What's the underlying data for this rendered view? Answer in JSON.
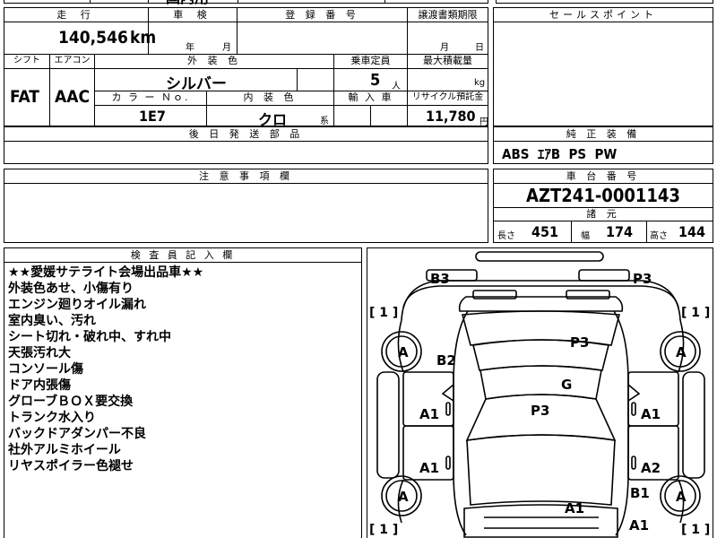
{
  "header_partial": {
    "text": "国内用"
  },
  "mileage": {
    "label": "走 行",
    "value": "140,546",
    "unit": "km"
  },
  "inspection": {
    "label": "車 検",
    "year_unit": "年",
    "month_unit": "月"
  },
  "registration": {
    "label": "登 録 番 号"
  },
  "transfer": {
    "label": "譲渡書類期限",
    "month_unit": "月",
    "day_unit": "日"
  },
  "shift": {
    "label": "シフト",
    "value": "FAT"
  },
  "aircon": {
    "label": "エアコン",
    "value": "AAC"
  },
  "exterior": {
    "label": "外 装 色",
    "value": "シルバー"
  },
  "capacity": {
    "label": "乗車定員",
    "value": "5",
    "unit": "人"
  },
  "max_load": {
    "label": "最大積載量",
    "unit": "kg"
  },
  "color_no": {
    "label": "カ ラ ー Ｎｏ.",
    "value": "1E7"
  },
  "interior": {
    "label": "内 装 色",
    "value": "クロ",
    "suffix": "系"
  },
  "import": {
    "label": "輸 入 車"
  },
  "recycle": {
    "label": "リサイクル預託金",
    "value": "11,780",
    "unit": "円"
  },
  "delivery_parts": {
    "label": "後 日 発 送 部 品"
  },
  "sales_point": {
    "label": "セールスポイント"
  },
  "equipment": {
    "label": "純 正 装 備",
    "value": "ABS  ｴｱB  PS  PW"
  },
  "caution": {
    "label": "注 意 事 項 欄"
  },
  "chassis": {
    "label": "車 台 番 号",
    "value": "AZT241-0001143"
  },
  "dimensions": {
    "label": "諸 元",
    "length_label": "長さ",
    "length": "451",
    "width_label": "幅",
    "width": "174",
    "height_label": "高さ",
    "height": "144"
  },
  "inspector": {
    "label": "検 査 員 記 入 欄",
    "lines": [
      "★★愛媛サテライト会場出品車★★",
      "外装色あせ、小傷有り",
      "エンジン廻りオイル漏れ",
      "室内臭い、汚れ",
      "シート切れ・破れ中、すれ中",
      "天張汚れ大",
      "コンソール傷",
      "ドア内張傷",
      "グローブＢＯＸ要交換",
      "トランク水入り",
      "バックドアダンパー不良",
      "社外アルミホイール",
      "リヤスポイラー色褪せ"
    ]
  },
  "car_map": {
    "marks": {
      "b3": "B3",
      "p3_top_right": "P3",
      "b2": "B2",
      "p3_roof": "P3",
      "g": "G",
      "p3_hood": "P3",
      "a1_left_front_door": "A1",
      "a1_right_front_door": "A1",
      "a1_left_rear_door": "A1",
      "a2_right_rear_door": "A2",
      "b1_right": "B1",
      "a1_bumper": "A1",
      "a1_bottom_right": "A1"
    },
    "tires": {
      "rl": "A",
      "rr": "A",
      "fl": "A",
      "fr": "A"
    },
    "brackets": {
      "tl": "[ 1 ]",
      "tr": "[ 1 ]",
      "bl": "[ 1 ]",
      "br": "[ 1 ]"
    }
  }
}
